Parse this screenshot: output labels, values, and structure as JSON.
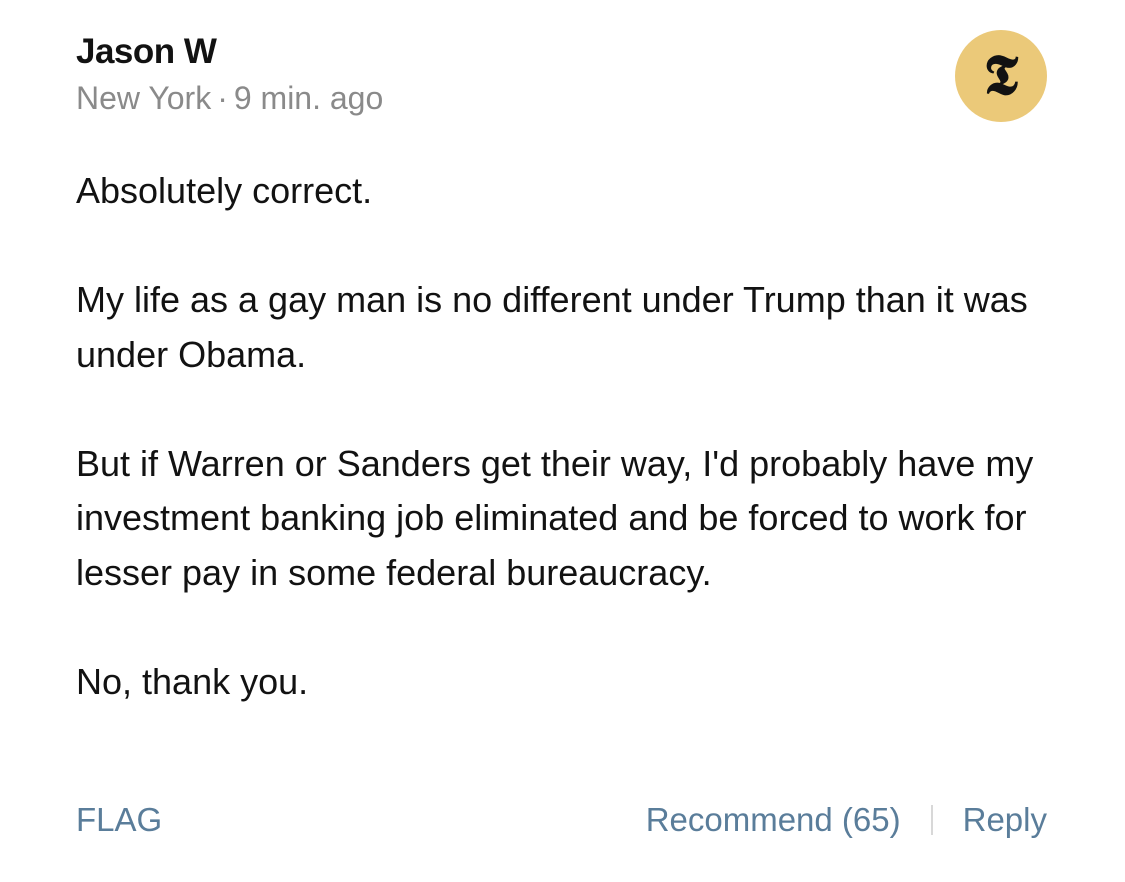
{
  "comment": {
    "author": "Jason W",
    "location": "New York",
    "separator": "·",
    "time": "9 min. ago",
    "badge_glyph": "𝕿",
    "badge_color": "#ebc979",
    "paragraphs": [
      "Absolutely correct.",
      "My life as a gay man is no different under Trump than it was under Obama.",
      "But if Warren or Sanders get their way, I'd probably have my investment banking job eliminated and be forced to work for lesser pay in some federal bureaucracy.",
      "No, thank you."
    ]
  },
  "actions": {
    "flag_label": "FLAG",
    "recommend_label": "Recommend (65)",
    "reply_label": "Reply",
    "link_color": "#5a7d9a"
  }
}
